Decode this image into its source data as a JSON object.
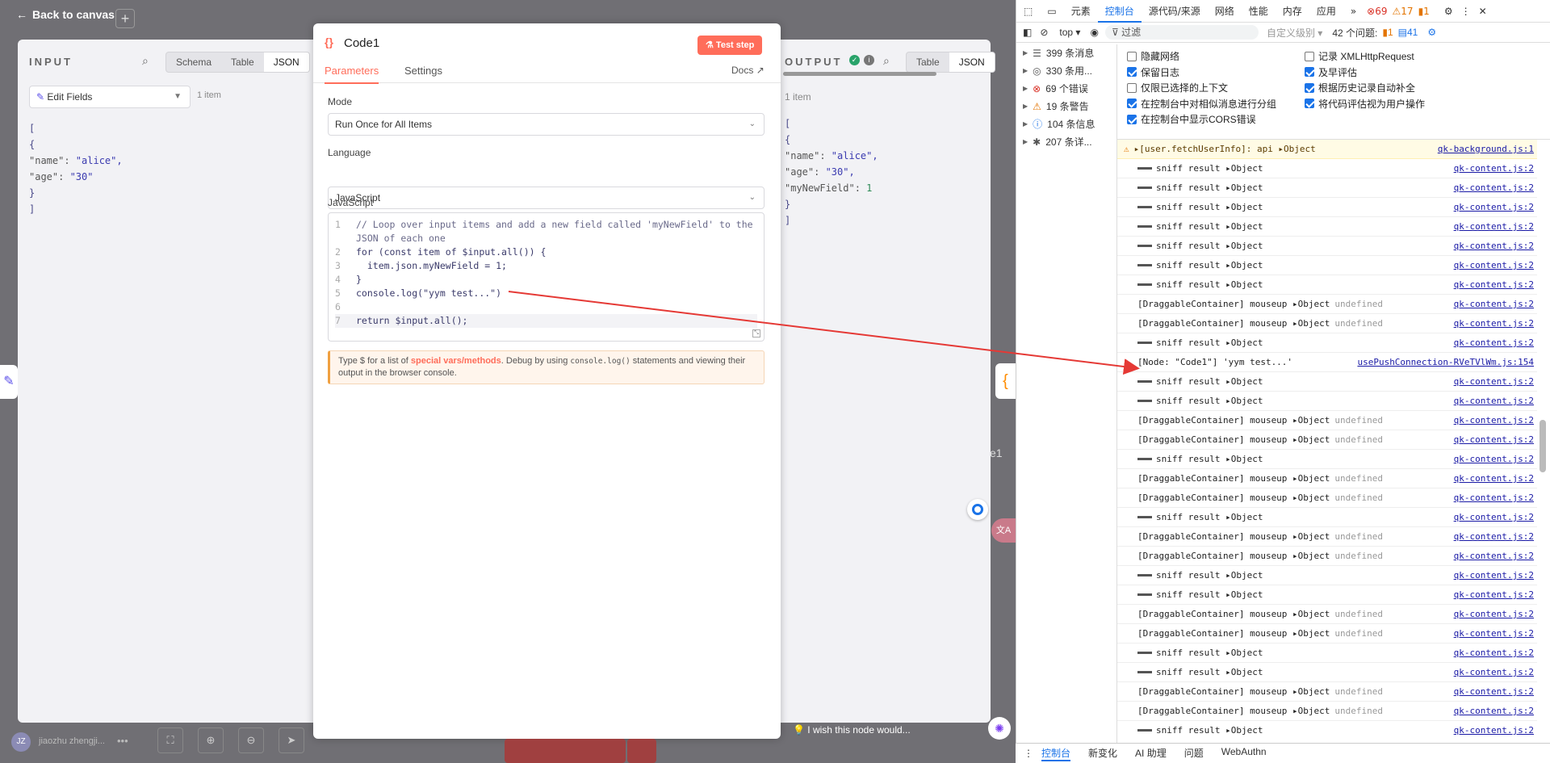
{
  "canvas": {
    "back_label": "Back to canvas",
    "plus": "+",
    "user": "jiaozhu zhengji...",
    "user_initials": "JZ",
    "feedback": "I wish this node would...",
    "node_label": "e1"
  },
  "input": {
    "title": "INPUT",
    "tabs": [
      "Schema",
      "Table",
      "JSON"
    ],
    "active_tab": "JSON",
    "source_node": "Edit Fields",
    "item_count": "1 item",
    "json_lines": [
      {
        "t": "["
      },
      {
        "t": "  {"
      },
      {
        "k": "\"name\"",
        "v": "\"alice\","
      },
      {
        "k": "\"age\"",
        "v": "\"30\""
      },
      {
        "t": "  }"
      },
      {
        "t": "]"
      }
    ]
  },
  "modal": {
    "title": "Code1",
    "test_step": "Test step",
    "tabs": [
      "Parameters",
      "Settings"
    ],
    "docs": "Docs",
    "mode_label": "Mode",
    "mode_value": "Run Once for All Items",
    "language_label": "Language",
    "language_value": "JavaScript",
    "code_label": "JavaScript",
    "code_lines": [
      {
        "n": "1",
        "c": "// Loop over input items and add a new field called 'myNewField' to the"
      },
      {
        "n": "",
        "c": "JSON of each one"
      },
      {
        "n": "2",
        "c": "for (const item of $input.all()) {"
      },
      {
        "n": "3",
        "c": "  item.json.myNewField = 1;"
      },
      {
        "n": "4",
        "c": "}"
      },
      {
        "n": "5",
        "c": "console.log(\"yym test...\")"
      },
      {
        "n": "6",
        "c": ""
      },
      {
        "n": "7",
        "c": "return $input.all();"
      }
    ],
    "hint_prefix": "Type $ for a list of ",
    "hint_link": "special vars/methods",
    "hint_mid": ". Debug by using ",
    "hint_code": "console.log()",
    "hint_suffix": " statements and viewing their output in the browser console."
  },
  "output": {
    "title": "OUTPUT",
    "tabs": [
      "Table",
      "JSON"
    ],
    "active_tab": "JSON",
    "item_count": "1 item",
    "json_lines": [
      {
        "t": "["
      },
      {
        "t": "  {"
      },
      {
        "k": "\"name\"",
        "v": "\"alice\","
      },
      {
        "k": "\"age\"",
        "v": "\"30\","
      },
      {
        "k": "\"myNewField\"",
        "n": "1"
      },
      {
        "t": "  }"
      },
      {
        "t": "]"
      }
    ]
  },
  "devtools": {
    "tabs": [
      "元素",
      "控制台",
      "源代码/来源",
      "网络",
      "性能",
      "内存",
      "应用"
    ],
    "active_tab": "控制台",
    "errors": "69",
    "warnings": "17",
    "info": "1",
    "context": "top",
    "filter_placeholder": "过滤",
    "level": "自定义级别",
    "issues_label": "42 个问题:",
    "issues_a": "1",
    "issues_b": "41",
    "sidebar": [
      {
        "icon": "list",
        "label": "399 条消息"
      },
      {
        "icon": "user",
        "label": "330 条用..."
      },
      {
        "icon": "error",
        "label": "69 个错误"
      },
      {
        "icon": "warning",
        "label": "19 条警告"
      },
      {
        "icon": "info",
        "label": "104 条信息"
      },
      {
        "icon": "bug",
        "label": "207 条详..."
      }
    ],
    "options_left": [
      {
        "label": "隐藏网络",
        "checked": false
      },
      {
        "label": "保留日志",
        "checked": true
      },
      {
        "label": "仅限已选择的上下文",
        "checked": false
      },
      {
        "label": "在控制台中对相似消息进行分组",
        "checked": true
      },
      {
        "label": "在控制台中显示CORS错误",
        "checked": true
      }
    ],
    "options_right": [
      {
        "label": "记录 XMLHttpRequest",
        "checked": false
      },
      {
        "label": "及早评估",
        "checked": true
      },
      {
        "label": "根据历史记录自动补全",
        "checked": true
      },
      {
        "label": "将代码评估视为用户操作",
        "checked": true
      }
    ],
    "logs": [
      {
        "type": "warn",
        "text": "▸[user.fetchUserInfo]: api  ▸Object",
        "src": "qk-background.js:1"
      },
      {
        "type": "sniff",
        "text": "sniff result  ▸Object",
        "src": "qk-content.js:2"
      },
      {
        "type": "sniff",
        "text": "sniff result  ▸Object",
        "src": "qk-content.js:2"
      },
      {
        "type": "sniff",
        "text": "sniff result  ▸Object",
        "src": "qk-content.js:2"
      },
      {
        "type": "sniff",
        "text": "sniff result  ▸Object",
        "src": "qk-content.js:2"
      },
      {
        "type": "sniff",
        "text": "sniff result  ▸Object",
        "src": "qk-content.js:2"
      },
      {
        "type": "sniff",
        "text": "sniff result  ▸Object",
        "src": "qk-content.js:2"
      },
      {
        "type": "sniff",
        "text": "sniff result  ▸Object",
        "src": "qk-content.js:2"
      },
      {
        "type": "drag",
        "text": "[DraggableContainer] mouseup  ▸Object",
        "und": "undefined",
        "src": "qk-content.js:2"
      },
      {
        "type": "drag",
        "text": "[DraggableContainer] mouseup  ▸Object",
        "und": "undefined",
        "src": "qk-content.js:2"
      },
      {
        "type": "sniff",
        "text": "sniff result  ▸Object",
        "src": "qk-content.js:2"
      },
      {
        "type": "node",
        "text": "[Node: \"Code1\"] 'yym test...'",
        "src": "usePushConnection-RVeTVlWm.js:154"
      },
      {
        "type": "sniff",
        "text": "sniff result  ▸Object",
        "src": "qk-content.js:2"
      },
      {
        "type": "sniff",
        "text": "sniff result  ▸Object",
        "src": "qk-content.js:2"
      },
      {
        "type": "drag",
        "text": "[DraggableContainer] mouseup  ▸Object",
        "und": "undefined",
        "src": "qk-content.js:2"
      },
      {
        "type": "drag",
        "text": "[DraggableContainer] mouseup  ▸Object",
        "und": "undefined",
        "src": "qk-content.js:2"
      },
      {
        "type": "sniff",
        "text": "sniff result  ▸Object",
        "src": "qk-content.js:2"
      },
      {
        "type": "drag",
        "text": "[DraggableContainer] mouseup  ▸Object",
        "und": "undefined",
        "src": "qk-content.js:2"
      },
      {
        "type": "drag",
        "text": "[DraggableContainer] mouseup  ▸Object",
        "und": "undefined",
        "src": "qk-content.js:2"
      },
      {
        "type": "sniff",
        "text": "sniff result  ▸Object",
        "src": "qk-content.js:2"
      },
      {
        "type": "drag",
        "text": "[DraggableContainer] mouseup  ▸Object",
        "und": "undefined",
        "src": "qk-content.js:2"
      },
      {
        "type": "drag",
        "text": "[DraggableContainer] mouseup  ▸Object",
        "und": "undefined",
        "src": "qk-content.js:2"
      },
      {
        "type": "sniff",
        "text": "sniff result  ▸Object",
        "src": "qk-content.js:2"
      },
      {
        "type": "sniff",
        "text": "sniff result  ▸Object",
        "src": "qk-content.js:2"
      },
      {
        "type": "drag",
        "text": "[DraggableContainer] mouseup  ▸Object",
        "und": "undefined",
        "src": "qk-content.js:2"
      },
      {
        "type": "drag",
        "text": "[DraggableContainer] mouseup  ▸Object",
        "und": "undefined",
        "src": "qk-content.js:2"
      },
      {
        "type": "sniff",
        "text": "sniff result  ▸Object",
        "src": "qk-content.js:2"
      },
      {
        "type": "sniff",
        "text": "sniff result  ▸Object",
        "src": "qk-content.js:2"
      },
      {
        "type": "drag",
        "text": "[DraggableContainer] mouseup  ▸Object",
        "und": "undefined",
        "src": "qk-content.js:2"
      },
      {
        "type": "drag",
        "text": "[DraggableContainer] mouseup  ▸Object",
        "und": "undefined",
        "src": "qk-content.js:2"
      },
      {
        "type": "sniff",
        "text": "sniff result  ▸Object",
        "src": "qk-content.js:2"
      }
    ],
    "bottom_tabs": [
      "控制台",
      "新变化",
      "AI 助理",
      "问题",
      "WebAuthn"
    ]
  },
  "colors": {
    "accent": "#ff6d5a",
    "devtools_blue": "#1a73e8",
    "arrow": "#e53935"
  }
}
